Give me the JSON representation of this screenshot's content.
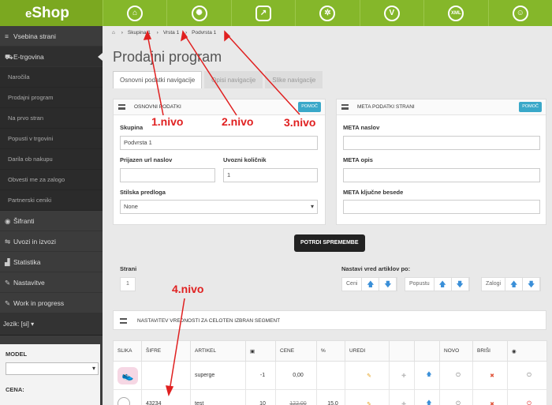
{
  "app": {
    "logo_small": "e",
    "logo_big": "Shop"
  },
  "topnav": [
    {
      "name": "home-icon",
      "glyph": "⌂"
    },
    {
      "name": "brain-icon",
      "glyph": "✺"
    },
    {
      "name": "export-icon",
      "glyph": "↗"
    },
    {
      "name": "runner-icon",
      "glyph": "✲"
    },
    {
      "name": "v-icon",
      "glyph": "V"
    },
    {
      "name": "xml-icon",
      "glyph": "XML"
    },
    {
      "name": "user-icon",
      "glyph": "☺"
    }
  ],
  "sidebar": {
    "items": [
      {
        "label": "Vsebina strani",
        "icon": "≡"
      },
      {
        "label": "E-trgovina",
        "icon": "⛟"
      }
    ],
    "subitems": [
      "Naročila",
      "Prodajni program",
      "Na prvo stran",
      "Popusti v trgovini",
      "Darila ob nakupu",
      "Obvesti me za zalogo",
      "Partnerski ceniki"
    ],
    "items2": [
      {
        "label": "Šifranti",
        "icon": "◉"
      },
      {
        "label": "Uvozi in izvozi",
        "icon": "⇋"
      },
      {
        "label": "Statistika",
        "icon": "▟"
      },
      {
        "label": "Nastavitve",
        "icon": "✎"
      },
      {
        "label": "Work in progress",
        "icon": "✎"
      }
    ],
    "language": "Jezik: [si]",
    "filter": {
      "model_label": "MODEL",
      "cena_label": "CENA:"
    }
  },
  "breadcrumb": {
    "home_icon": "home-icon",
    "items": [
      "Skupina 1",
      "Vrsta 1",
      "Podvrsta 1"
    ]
  },
  "page_title": "Prodajni program",
  "tabs": [
    "Osnovni podatki navigacije",
    "Opisi navigacije",
    "Slike navigacije"
  ],
  "panel_basic": {
    "title": "OSNOVNI PODATKI",
    "help": "POMOČ",
    "skupina_label": "Skupina",
    "skupina_value": "Podvrsta 1",
    "url_label": "Prijazen url naslov",
    "url_value": "",
    "qty_label": "Uvozni količnik",
    "qty_value": "1",
    "tpl_label": "Stilska predloga",
    "tpl_value": "None"
  },
  "panel_meta": {
    "title": "META PODATKI STRANI",
    "help": "POMOČ",
    "title_label": "META naslov",
    "desc_label": "META opis",
    "kw_label": "META ključne besede"
  },
  "save_button": "POTRDI SPREMEMBE",
  "paging": {
    "label": "Strani",
    "value": "1"
  },
  "sort": {
    "label": "Nastavi vred artiklov po:",
    "groups": [
      "Ceni",
      "Popustu",
      "Zalogi"
    ]
  },
  "segment_title": "NASTAVITEV VREDNOSTI ZA CELOTEN IZBRAN SEGMENT",
  "table": {
    "headers": [
      "SLIKA",
      "ŠIFRE",
      "ARTIKEL",
      "",
      "CENE",
      "%",
      "UREDI",
      "",
      "",
      "NOVO",
      "BRIŠI",
      ""
    ],
    "rows": [
      {
        "sifra": "",
        "artikel": "superge",
        "zaloga": "-1",
        "cena": "0,00",
        "pct": ""
      },
      {
        "sifra": "43234",
        "artikel": "test",
        "zaloga": "10",
        "cena": "122,00",
        "pct": "15,0"
      }
    ]
  },
  "annotations": [
    "1.nivo",
    "2.nivo",
    "3.nivo",
    "4.nivo"
  ],
  "colors": {
    "brand_green": "#85b72a",
    "sidebar": "#3c3c3c",
    "help_btn": "#3aa8c9",
    "annotation": "#e02020",
    "arrow_up": "#3a8fd8"
  }
}
